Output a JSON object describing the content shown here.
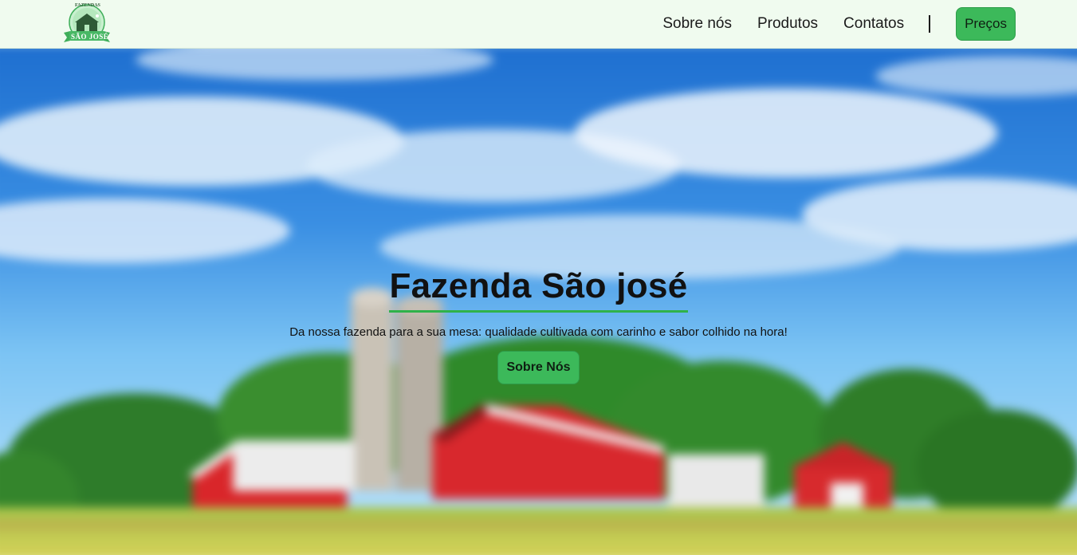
{
  "header": {
    "logo": {
      "icon": "farm-logo-icon",
      "top_text": "FAZENDAS",
      "ribbon_text": "SÃO JOSÉ",
      "brand_color": "#3fae5a"
    },
    "nav": {
      "items": [
        {
          "label": "Sobre nós"
        },
        {
          "label": "Produtos"
        },
        {
          "label": "Contatos"
        }
      ],
      "cta_label": "Preços"
    }
  },
  "hero": {
    "title": "Fazenda São josé",
    "subtitle": "Da nossa fazenda para a sua mesa: qualidade cultivada com carinho e sabor colhido na hora!",
    "button_label": "Sobre Nós",
    "background": "blurred-farm-landscape"
  },
  "colors": {
    "header_bg": "#f0fbef",
    "accent": "#3cb95a",
    "title_underline": "#2fb24a",
    "text": "#111111"
  }
}
